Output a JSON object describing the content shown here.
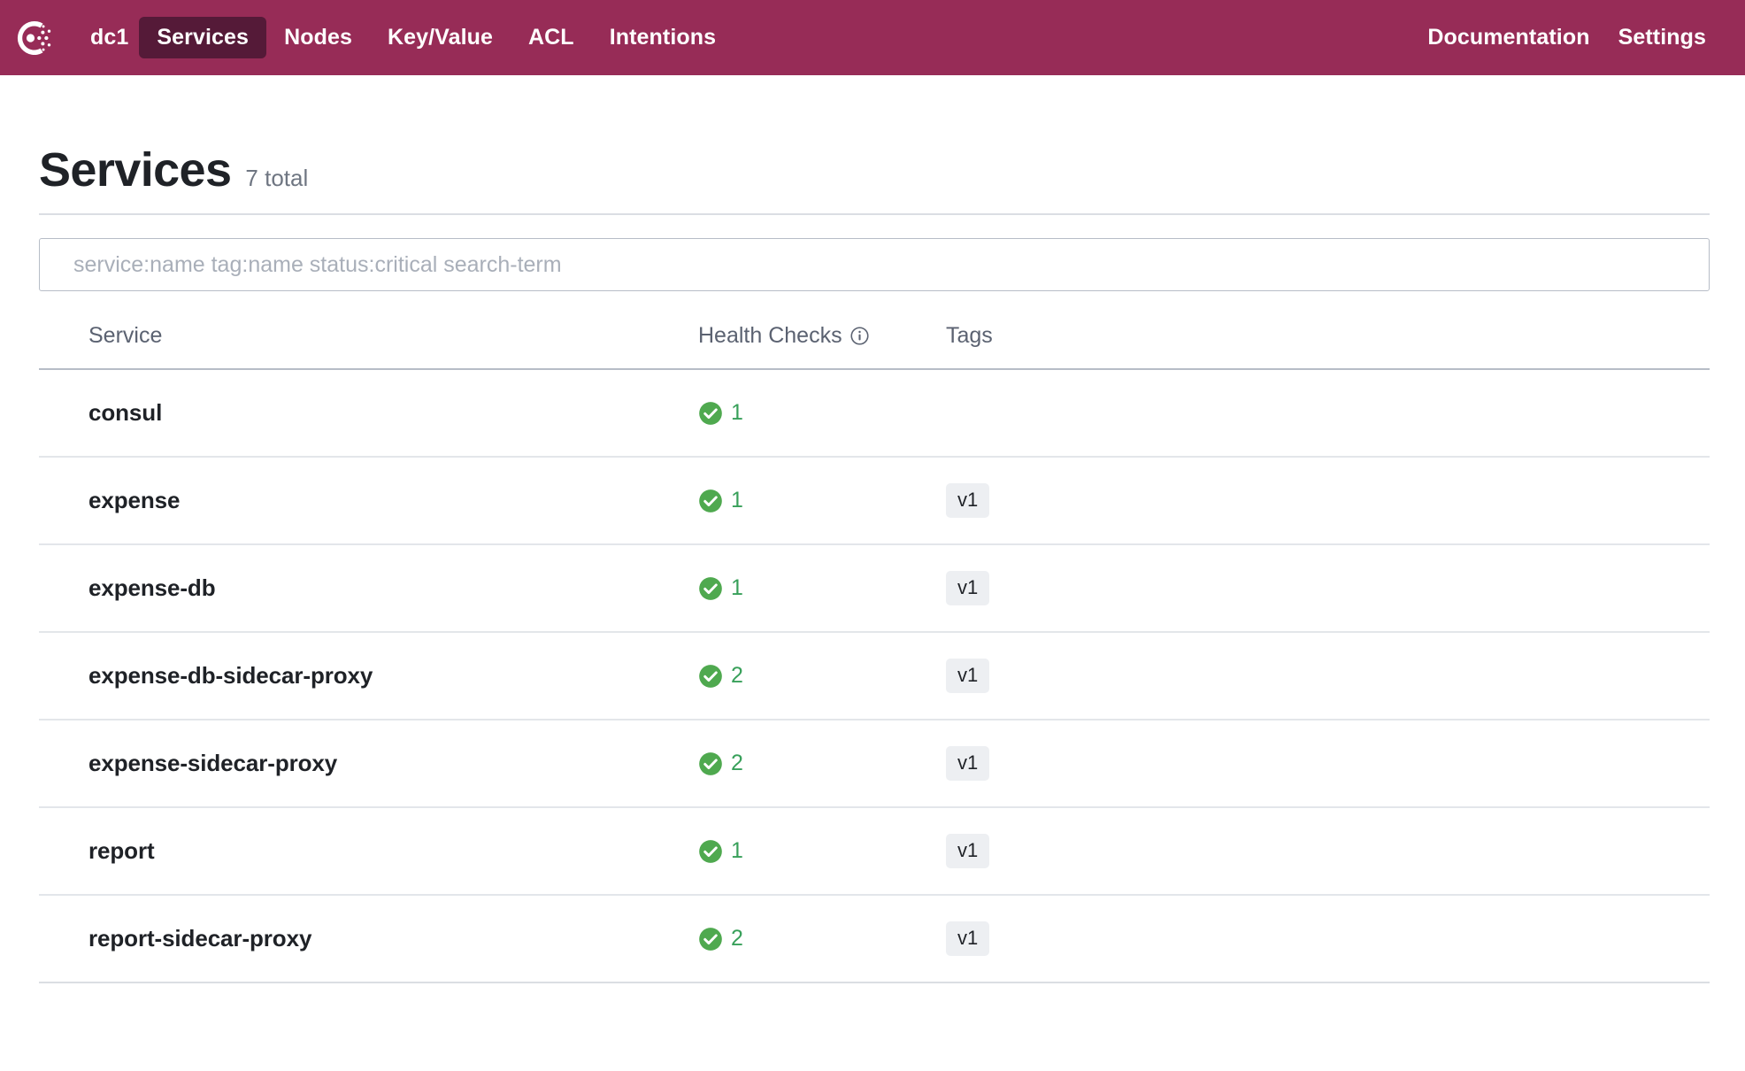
{
  "nav": {
    "logo_icon": "consul-logo-icon",
    "datacenter": "dc1",
    "items": [
      {
        "label": "Services",
        "active": true
      },
      {
        "label": "Nodes",
        "active": false
      },
      {
        "label": "Key/Value",
        "active": false
      },
      {
        "label": "ACL",
        "active": false
      },
      {
        "label": "Intentions",
        "active": false
      }
    ],
    "right_items": [
      {
        "label": "Documentation"
      },
      {
        "label": "Settings"
      }
    ],
    "colors": {
      "background": "#972C57",
      "active_background": "#551A38",
      "text": "#FFFFFF"
    }
  },
  "page": {
    "title": "Services",
    "total_label": "7 total"
  },
  "search": {
    "value": "",
    "placeholder": "service:name tag:name status:critical search-term"
  },
  "table": {
    "columns": [
      {
        "label": "Service",
        "icon": null
      },
      {
        "label": "Health Checks",
        "icon": "info-icon"
      },
      {
        "label": "Tags",
        "icon": null
      }
    ],
    "rows": [
      {
        "service": "consul",
        "status_icon": "check-circle-icon",
        "health_count": "1",
        "tags": []
      },
      {
        "service": "expense",
        "status_icon": "check-circle-icon",
        "health_count": "1",
        "tags": [
          "v1"
        ]
      },
      {
        "service": "expense-db",
        "status_icon": "check-circle-icon",
        "health_count": "1",
        "tags": [
          "v1"
        ]
      },
      {
        "service": "expense-db-sidecar-proxy",
        "status_icon": "check-circle-icon",
        "health_count": "2",
        "tags": [
          "v1"
        ]
      },
      {
        "service": "expense-sidecar-proxy",
        "status_icon": "check-circle-icon",
        "health_count": "2",
        "tags": [
          "v1"
        ]
      },
      {
        "service": "report",
        "status_icon": "check-circle-icon",
        "health_count": "1",
        "tags": [
          "v1"
        ]
      },
      {
        "service": "report-sidecar-proxy",
        "status_icon": "check-circle-icon",
        "health_count": "2",
        "tags": [
          "v1"
        ]
      }
    ],
    "colors": {
      "passing": "#38A05A",
      "tag_background": "#EDEFF2",
      "header_text": "#5B6271"
    }
  }
}
